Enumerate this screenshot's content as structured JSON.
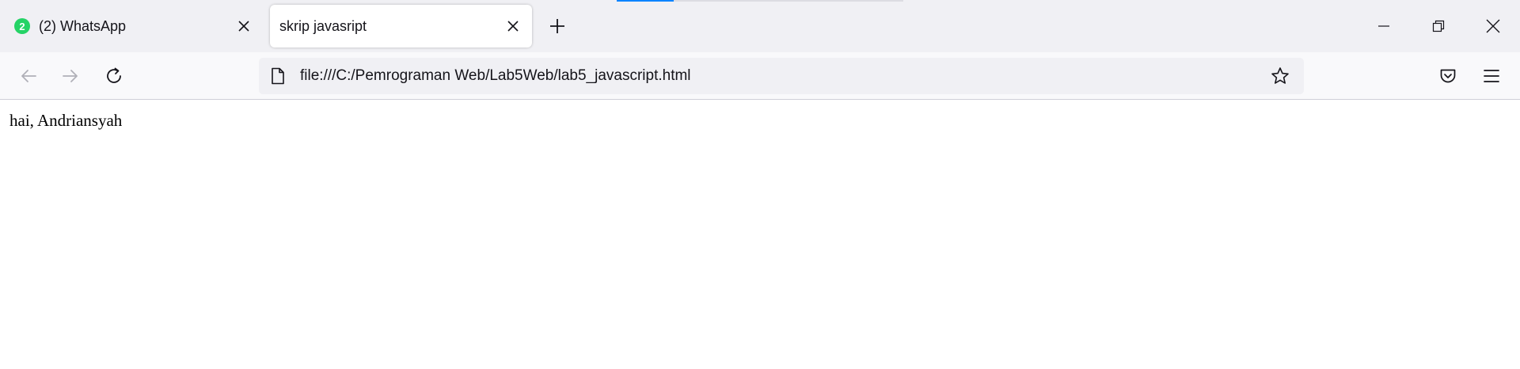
{
  "tabs": [
    {
      "label": "(2) WhatsApp",
      "badge": "2",
      "favicon": "whatsapp-icon",
      "active": false
    },
    {
      "label": "skrip javasript",
      "active": true
    }
  ],
  "toolbar": {
    "new_tab_icon": "plus-icon",
    "back_icon": "back-arrow-icon",
    "forward_icon": "forward-arrow-icon",
    "reload_icon": "reload-icon",
    "pocket_icon": "pocket-icon",
    "menu_icon": "hamburger-menu-icon"
  },
  "urlbar": {
    "url": "file:///C:/Pemrograman Web/Lab5Web/lab5_javascript.html",
    "page_icon": "document-icon",
    "bookmark_icon": "star-icon"
  },
  "window_controls": [
    "minimize-icon",
    "restore-icon",
    "close-icon"
  ],
  "page": {
    "text": "hai, Andriansyah"
  },
  "colors": {
    "tabstrip_bg": "#f0f0f4",
    "navbar_bg": "#f9f9fb",
    "urlbar_bg": "#f0f0f4",
    "accent": "#0a84ff",
    "whatsapp_green": "#25d366"
  }
}
